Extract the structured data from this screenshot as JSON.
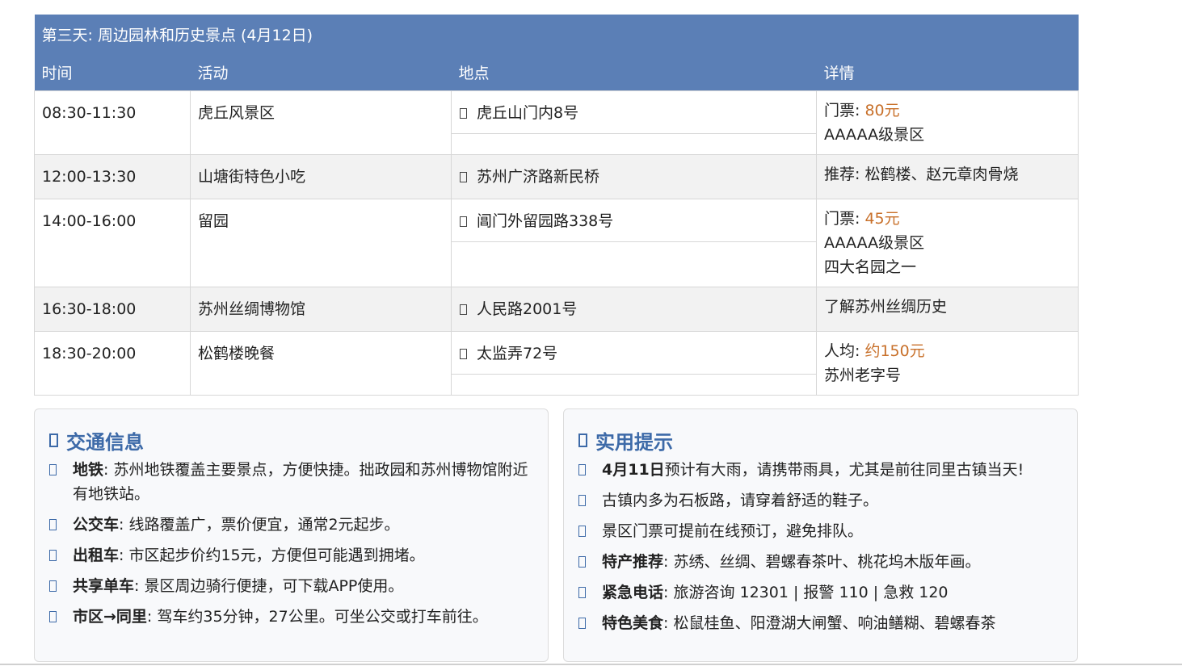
{
  "itinerary": {
    "title": "第三天: 周边园林和历史景点 (4月12日)",
    "headers": {
      "time": "时间",
      "activity": "活动",
      "location": "地点",
      "details": "详情"
    },
    "rows": [
      {
        "time": "08:30-11:30",
        "activity": "虎丘风景区",
        "location": "虎丘山门内8号",
        "details": [
          {
            "label": "门票: ",
            "value": "80元"
          },
          {
            "text": "AAAAA级景区"
          }
        ]
      },
      {
        "time": "12:00-13:30",
        "activity": "山塘街特色小吃",
        "location": "苏州广济路新民桥",
        "details": [
          {
            "text": "推荐: 松鹤楼、赵元章肉骨烧"
          }
        ]
      },
      {
        "time": "14:00-16:00",
        "activity": "留园",
        "location": "阊门外留园路338号",
        "details": [
          {
            "label": "门票: ",
            "value": "45元"
          },
          {
            "text": "AAAAA级景区"
          },
          {
            "text": "四大名园之一"
          }
        ]
      },
      {
        "time": "16:30-18:00",
        "activity": "苏州丝绸博物馆",
        "location": "人民路2001号",
        "details": [
          {
            "text": "了解苏州丝绸历史"
          }
        ]
      },
      {
        "time": "18:30-20:00",
        "activity": "松鹤楼晚餐",
        "location": "太监弄72号",
        "details": [
          {
            "label": "人均: ",
            "value": "约150元"
          },
          {
            "text": "苏州老字号"
          }
        ]
      }
    ]
  },
  "transport": {
    "title": "交通信息",
    "items": [
      {
        "label": "地铁",
        "text": ": 苏州地铁覆盖主要景点，方便快捷。拙政园和苏州博物馆附近有地铁站。"
      },
      {
        "label": "公交车",
        "text": ": 线路覆盖广，票价便宜，通常2元起步。"
      },
      {
        "label": "出租车",
        "text": ": 市区起步价约15元，方便但可能遇到拥堵。"
      },
      {
        "label": "共享单车",
        "text": ": 景区周边骑行便捷，可下载APP使用。"
      },
      {
        "label": "市区→同里",
        "text": ": 驾车约35分钟，27公里。可坐公交或打车前往。"
      }
    ]
  },
  "tips": {
    "title": "实用提示",
    "items": [
      {
        "label": "4月11日",
        "text": "预计有大雨，请携带雨具，尤其是前往同里古镇当天!"
      },
      {
        "label": "",
        "text": "古镇内多为石板路，请穿着舒适的鞋子。"
      },
      {
        "label": "",
        "text": "景区门票可提前在线预订，避免排队。"
      },
      {
        "label": "特产推荐",
        "text": ": 苏绣、丝绸、碧螺春茶叶、桃花坞木版年画。"
      },
      {
        "label": "紧急电话",
        "text": ": 旅游咨询 12301 | 报警 110 | 急救 120"
      },
      {
        "label": "特色美食",
        "text": ": 松鼠桂鱼、阳澄湖大闸蟹、响油鳝糊、碧螺春茶"
      }
    ]
  },
  "icons": {
    "location": "map-pin-icon",
    "transport_title": "bus-icon",
    "tips_title": "lightbulb-icon",
    "bullet": "missing-glyph-icon"
  },
  "colors": {
    "header_bg": "#5b7fb6",
    "accent": "#3d6aa8",
    "price": "#c8702a",
    "row_alt": "#f2f2f2"
  }
}
